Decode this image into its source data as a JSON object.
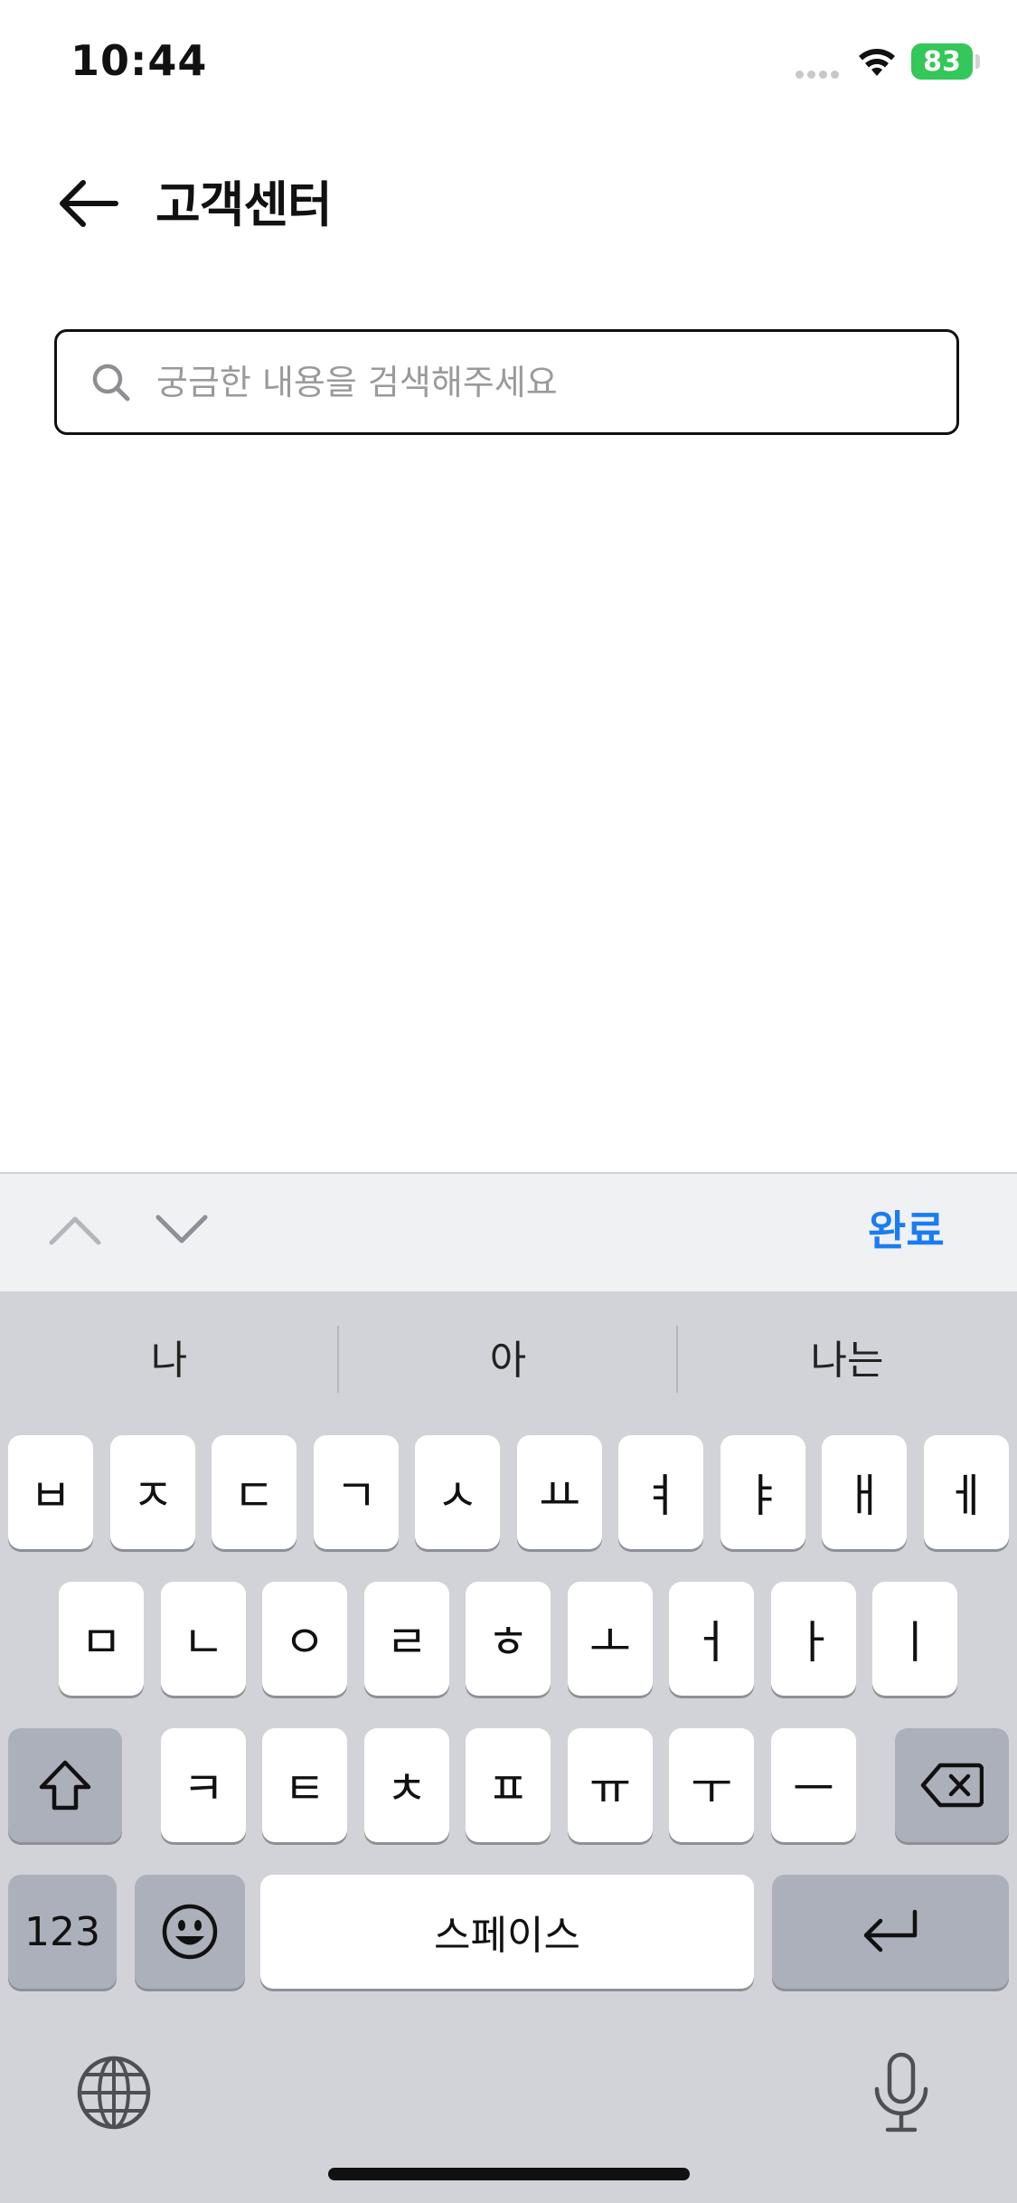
{
  "status_bar": {
    "time": "10:44",
    "battery": "83"
  },
  "header": {
    "title": "고객센터"
  },
  "search": {
    "placeholder": "궁금한 내용을 검색해주세요",
    "value": ""
  },
  "accessory": {
    "done_label": "완료"
  },
  "keyboard": {
    "suggestions": [
      "나",
      "아",
      "나는"
    ],
    "row1": [
      "ㅂ",
      "ㅈ",
      "ㄷ",
      "ㄱ",
      "ㅅ",
      "ㅛ",
      "ㅕ",
      "ㅑ",
      "ㅐ",
      "ㅔ"
    ],
    "row2": [
      "ㅁ",
      "ㄴ",
      "ㅇ",
      "ㄹ",
      "ㅎ",
      "ㅗ",
      "ㅓ",
      "ㅏ",
      "ㅣ"
    ],
    "row3": [
      "ㅋ",
      "ㅌ",
      "ㅊ",
      "ㅍ",
      "ㅠ",
      "ㅜ",
      "ㅡ"
    ],
    "numbers_label": "123",
    "space_label": "스페이스"
  },
  "icons": {
    "back": "arrow-left-icon",
    "search": "search-icon",
    "wifi": "wifi-icon",
    "shift": "shift-icon",
    "delete": "backspace-icon",
    "emoji": "emoji-icon",
    "return": "return-icon",
    "globe": "globe-icon",
    "mic": "microphone-icon"
  },
  "colors": {
    "accent": "#1a7cf0",
    "battery": "#34c759",
    "keyboard_bg": "#d1d3d9"
  }
}
